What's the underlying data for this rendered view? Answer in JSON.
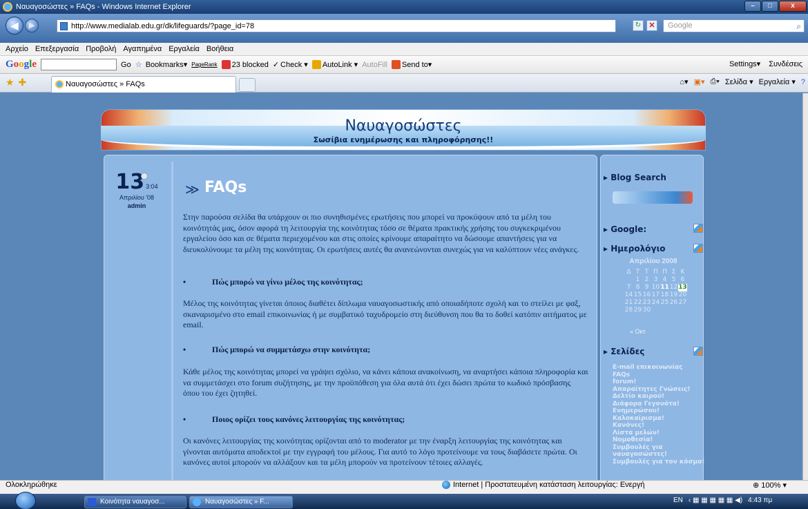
{
  "window": {
    "title": "Ναυαγοσώστες » FAQs - Windows Internet Explorer",
    "controls": [
      "–",
      "□",
      "x"
    ]
  },
  "address_bar": {
    "url": "http://www.medialab.edu.gr/dk/lifeguards/?page_id=78",
    "search_placeholder": "Google"
  },
  "menu": [
    "Αρχείο",
    "Επεξεργασία",
    "Προβολή",
    "Αγαπημένα",
    "Εργαλεία",
    "Βοήθεια"
  ],
  "google_toolbar": {
    "logo": "Google",
    "go": "Go",
    "bookmarks": "Bookmarks▾",
    "pagerank": "PageRank",
    "blocked": "23 blocked",
    "check": "Check ▾",
    "autolink": "AutoLink ▾",
    "autofill": "AutoFill",
    "sendto": "Send to▾",
    "settings": "Settings▾",
    "connections": "Συνδέσεις"
  },
  "tab": {
    "label": "Ναυαγοσώστες » FAQs"
  },
  "command_bar": {
    "page": "Σελίδα ▾",
    "tools": "Εργαλεία ▾"
  },
  "site": {
    "title": "Ναυαγοσώστες",
    "tagline": "Σωσίβια ενημέρωσης και πληροφόρησης!!"
  },
  "post": {
    "day": "13",
    "time": "3:04",
    "month": "Απριλίου '08",
    "author": "admin",
    "title": "FAQs",
    "intro": "Στην παρούσα σελίδα θα υπάρχουν οι πιο συνηθισμένες ερωτήσεις που μπορεί να προκύψουν από τα μέλη του κοινότητάς μας, όσον αφορά τη λειτουργία της κοινότητας τόσο σε θέματα πρακτικής χρήσης του συγκεκριμένου εργαλείου όσο και σε θέματα περιεχομένου και στις οποίες κρίνουμε απαραίτητο να δώσουμε απαντήσεις για να διευκολύνουμε τα μέλη της κοινότητας. Οι ερωτήσεις αυτές θα ανανεώνονται συνεχώς για να καλύπτουν νέες ανάγκες.",
    "q1": "Πώς μπορώ να γίνω μέλος της κοινότητας;",
    "a1": "Μέλος της κοινότητας γίνεται όποιος διαθέτει δίπλωμα ναυαγοσωστικής από οποιαδήποτε σχολή και το στείλει με φαξ, σκαναρισμένο στο email επικοινωνίας ή με συμβατικό ταχυδρομείο στη διεύθυνση που θα το δοθεί κατόπιν αιτήματος με email.",
    "q2": "Πώς μπορώ να συμμετάσχω στην κοινότητα;",
    "a2": "Κάθε μέλος της κοινότητας μπορεί να γράψει σχόλιο, να κάνει κάποια ανακοίνωση, να αναρτήσει κάποια πληροφορία και να συμμετάσχει στο forum συζήτησης, με την προϋπόθεση για όλα αυτά ότι έχει δώσει πρώτα το κωδικό πρόσβασης όπου του έχει ζητηθεί.",
    "q3": "Ποιος ορίζει τους κανόνες λειτουργίας της κοινότητας;",
    "a3": "Οι κανόνες λειτουργίας της κοινότητας ορίζονται από το moderator με την έναρξη λειτουργίας της κοινότητας και γίνονται αυτόματα αποδεκτοί με την εγγραφή του μέλους. Για αυτό το λόγο προτείνουμε να τους διαβάσετε πρώτα. Οι κανόνες αυτοί μπορούν να αλλάξουν και τα μέλη μπορούν να προτείνουν τέτοιες αλλαγές.",
    "bullet": "•"
  },
  "sidebar": {
    "blog_search": "Blog Search",
    "google": "Google:",
    "calendar_title": "Ημερολόγιο",
    "calendar_month": "Απριλίου 2008",
    "calendar_head": [
      "Δ",
      "Τ",
      "Τ",
      "Π",
      "Π",
      "Σ",
      "Κ"
    ],
    "calendar_prev": "« Οκτ",
    "pages_title": "Σελίδες",
    "pages": [
      "E-mail επικοινωνίας",
      "FAQs",
      "forum!",
      "Απαραίτητες Γνώσεις!",
      "Δελτίο καιρού!",
      "Διάφορα Γεγονότα!",
      "Ενημερώσου!",
      "Καλοκαίρισμα!",
      "Κανόνες!",
      "Λίστα μελών!",
      "Νομοθεσία!",
      "Συμβουλές για",
      "ναυαγοσώστες!",
      "Συμβουλές για τον κόσμο!"
    ]
  },
  "status": {
    "left": "Ολοκληρώθηκε",
    "zone": "Internet | Προστατευμένη κατάσταση λειτουργίας: Ενεργή",
    "zoom": "100%"
  },
  "taskbar": {
    "item1": "Κοινότητα ναυαγοσ...",
    "item2": "Ναυαγοσώστες » F...",
    "lang": "EN",
    "clock": "4:43 πμ"
  }
}
